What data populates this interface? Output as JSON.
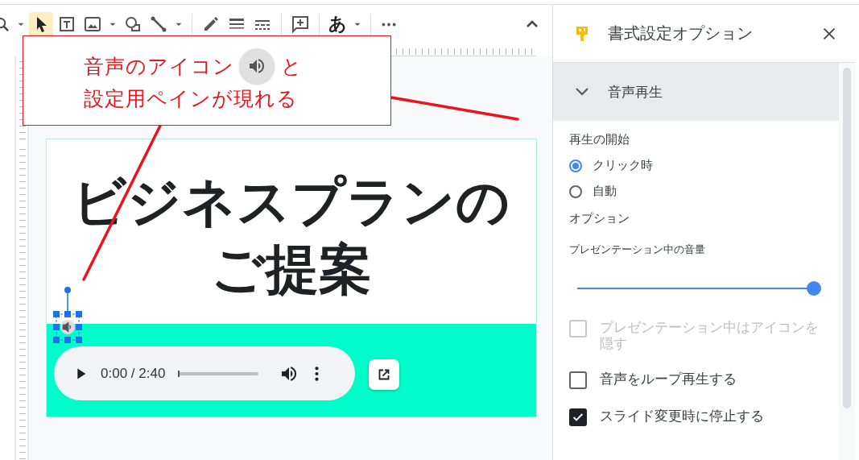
{
  "toolbar": {
    "tools": [
      {
        "kind": "zoom",
        "selected": false
      },
      {
        "kind": "caret",
        "selected": false
      },
      {
        "kind": "select",
        "selected": true
      },
      {
        "kind": "textbox",
        "selected": false
      },
      {
        "kind": "image",
        "selected": false
      },
      {
        "kind": "caret",
        "selected": false
      },
      {
        "kind": "shape",
        "selected": false
      },
      {
        "kind": "line",
        "selected": false
      },
      {
        "kind": "caret",
        "selected": false
      },
      {
        "kind": "pen",
        "selected": false,
        "sep_before": true
      },
      {
        "kind": "weight",
        "selected": false
      },
      {
        "kind": "dash",
        "selected": false
      },
      {
        "kind": "comment",
        "selected": false,
        "sep_before": true
      },
      {
        "kind": "text",
        "label": "あ",
        "selected": false,
        "sep_before": true
      },
      {
        "kind": "caret",
        "selected": false
      },
      {
        "kind": "more",
        "selected": false,
        "sep_before": true
      }
    ]
  },
  "slide": {
    "title_lines": [
      "ビジネスプランの",
      "ご提案"
    ]
  },
  "audio_player": {
    "time": "0:00 / 2:40",
    "level": 0
  },
  "callout": {
    "line1_before": "音声のアイコン",
    "line1_after": "と",
    "line2": "設定用ペインが現れる"
  },
  "panel": {
    "title": "書式設定オプション",
    "section": {
      "title": "音声再生",
      "expanded": true
    },
    "start_label": "再生の開始",
    "start_options": [
      {
        "label": "クリック時",
        "selected": true
      },
      {
        "label": "自動",
        "selected": false
      }
    ],
    "options_label": "オプション",
    "volume": {
      "label": "プレゼンテーション中の音量",
      "level": 1
    },
    "checkboxes": [
      {
        "label": "プレゼンテーション中はアイコンを隠す",
        "checked": false,
        "disabled": true
      },
      {
        "label": "音声をループ再生する",
        "checked": false,
        "disabled": false
      },
      {
        "label": "スライド変更時に停止する",
        "checked": true,
        "disabled": false
      }
    ]
  }
}
